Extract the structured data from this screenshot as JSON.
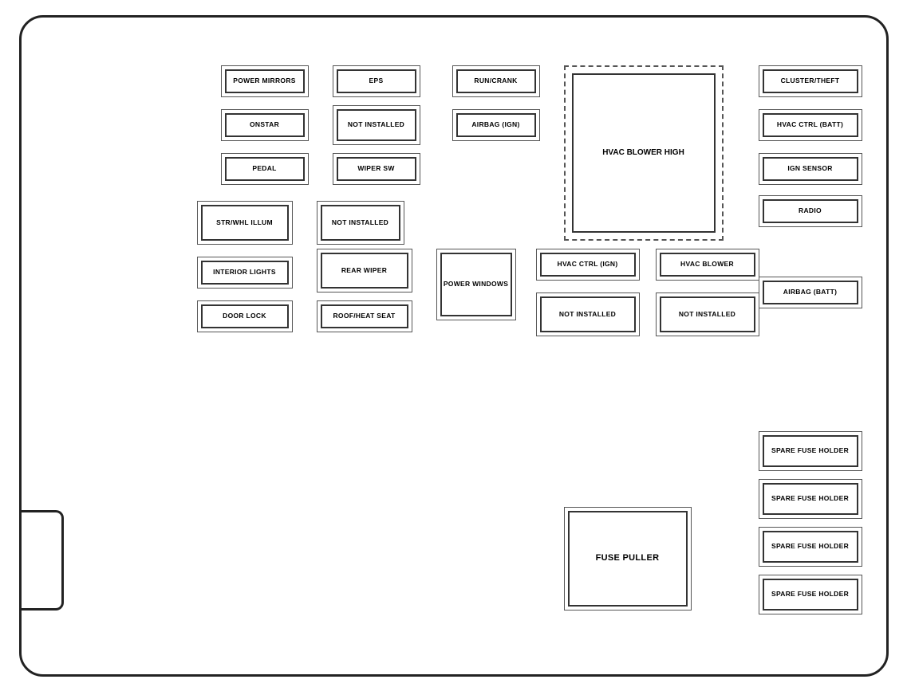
{
  "fuses": {
    "top_section": {
      "power_mirrors": "POWER MIRRORS",
      "eps": "EPS",
      "run_crank": "RUN/CRANK",
      "onstar": "ONSTAR",
      "not_installed_1": "NOT INSTALLED",
      "airbag_ign": "AIRBAG (IGN)",
      "pedal": "PEDAL",
      "wiper_sw": "WIPER SW",
      "hvac_blower_high": "HVAC BLOWER HIGH"
    },
    "right_column": {
      "cluster_theft": "CLUSTER/THEFT",
      "hvac_ctrl_batt": "HVAC CTRL (BATT)",
      "ign_sensor": "IGN SENSOR",
      "radio": "RADIO",
      "airbag_batt": "AIRBAG (BATT)"
    },
    "mid_section": {
      "str_whl_illum": "STR/WHL ILLUM",
      "not_installed_2": "NOT INSTALLED",
      "interior_lights": "INTERIOR LIGHTS",
      "rear_wiper": "REAR WIPER",
      "power_windows": "POWER WINDOWS",
      "hvac_ctrl_ign": "HVAC CTRL (IGN)",
      "hvac_blower": "HVAC BLOWER",
      "door_lock": "DOOR LOCK",
      "roof_heat_seat": "ROOF/HEAT SEAT",
      "not_installed_3": "NOT INSTALLED",
      "not_installed_4": "NOT INSTALLED"
    },
    "bottom_section": {
      "fuse_puller": "FUSE PULLER",
      "spare1": "SPARE FUSE HOLDER",
      "spare2": "SPARE FUSE HOLDER",
      "spare3": "SPARE FUSE HOLDER",
      "spare4": "SPARE FUSE HOLDER"
    }
  }
}
